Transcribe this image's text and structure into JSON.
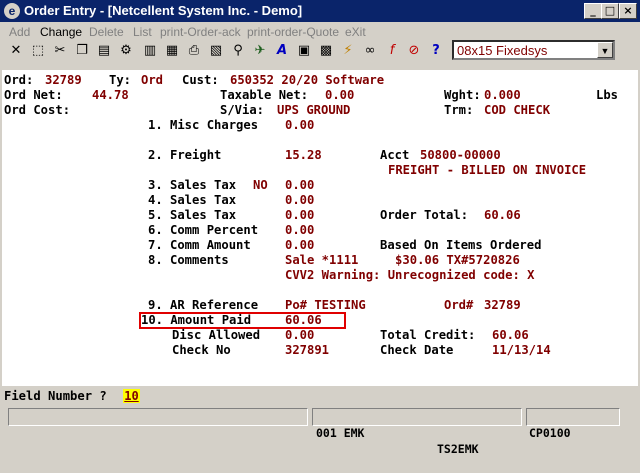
{
  "window": {
    "title": "Order Entry - [Netcellent System Inc. - Demo]"
  },
  "menu": [
    {
      "label": "Add",
      "enabled": false
    },
    {
      "label": "Change",
      "enabled": true
    },
    {
      "label": "Delete",
      "enabled": false
    },
    {
      "label": "List",
      "enabled": false
    },
    {
      "label": "print-Order-ack",
      "enabled": false
    },
    {
      "label": "print-order-Quote",
      "enabled": false
    },
    {
      "label": "eXit",
      "enabled": false
    }
  ],
  "toolbar": {
    "font_select_value": "08x15 Fixedsys",
    "icons": [
      "close-icon",
      "select-icon",
      "cut-icon",
      "copy-icon",
      "paste-icon",
      "settings-icon",
      "note-icon",
      "cards-icon",
      "printer-icon",
      "chart-icon",
      "search-icon",
      "run-icon",
      "font-icon",
      "find-icon",
      "calculator-icon",
      "flash-icon",
      "link-icon",
      "function-icon",
      "stop-icon",
      "help-icon"
    ]
  },
  "header": {
    "ord_label": "Ord:",
    "ord_value": "32789",
    "ty_label": "Ty:",
    "ty_value": "Ord",
    "cust_label": "Cust:",
    "cust_value": "650352 20/20 Software",
    "ord_net_label": "Ord Net:",
    "ord_net_value": "44.78",
    "taxable_net_label": "Taxable Net:",
    "taxable_net_value": "0.00",
    "wght_label": "Wght:",
    "wght_value": "0.000",
    "wght_unit": "Lbs",
    "ord_cost_label": "Ord Cost:",
    "svia_label": "S/Via:",
    "svia_value": "UPS GROUND",
    "trm_label": "Trm:",
    "trm_value": "COD CHECK"
  },
  "fields": {
    "misc_charges": {
      "label": "1. Misc Charges",
      "value": "0.00"
    },
    "freight": {
      "label": "2. Freight",
      "value": "15.28",
      "acct_label": "Acct",
      "acct_value": "50800-00000",
      "note": "FREIGHT - BILLED ON INVOICE"
    },
    "sales_tax_3": {
      "label": "3. Sales Tax",
      "flag": "NO",
      "value": "0.00"
    },
    "sales_tax_4": {
      "label": "4. Sales Tax",
      "value": "0.00"
    },
    "sales_tax_5": {
      "label": "5. Sales Tax",
      "value": "0.00",
      "order_total_label": "Order Total:",
      "order_total_value": "60.06"
    },
    "comm_percent": {
      "label": "6. Comm Percent",
      "value": "0.00"
    },
    "comm_amount": {
      "label": "7. Comm Amount",
      "value": "0.00",
      "note": "Based On Items Ordered"
    },
    "comments": {
      "label": "8. Comments",
      "line1": "Sale *1111     $30.06 TX#5720826",
      "line2": "CVV2 Warning: Unrecognized code: X"
    },
    "ar_reference": {
      "label": "9. AR Reference",
      "value": "Po# TESTING",
      "ord_label": "Ord#",
      "ord_value": "32789"
    },
    "amount_paid": {
      "label": "10. Amount Paid",
      "value": "60.06"
    },
    "disc_allowed": {
      "label": "Disc Allowed",
      "value": "0.00",
      "total_credit_label": "Total Credit:",
      "total_credit_value": "60.06"
    },
    "check_no": {
      "label": "Check No",
      "value": "327891",
      "check_date_label": "Check Date",
      "check_date_value": "11/13/14"
    }
  },
  "prompt": {
    "label": "Field Number ?",
    "value": "10"
  },
  "status": {
    "user": "001 EMK",
    "station": "TS2EMK",
    "code": "CP0100"
  },
  "colors": {
    "title_bar": "#0a246a",
    "value_text": "#800000",
    "highlight_box": "#e00000",
    "input_bg": "#ffff00"
  }
}
